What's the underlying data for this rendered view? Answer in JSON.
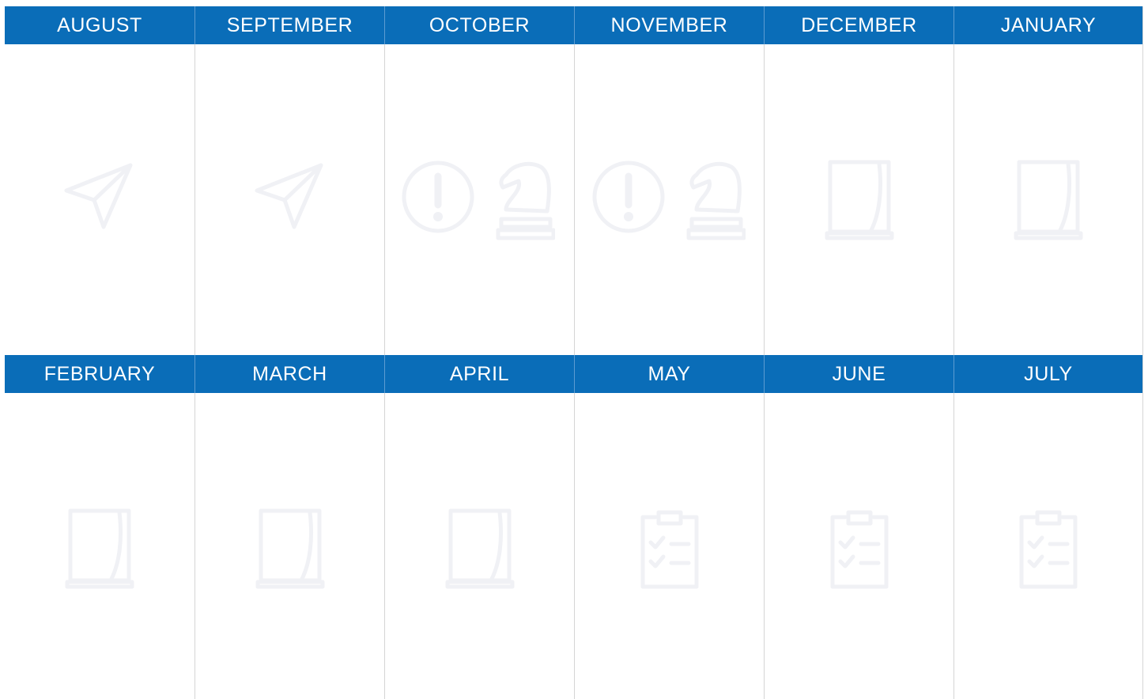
{
  "months_top": [
    {
      "name": "AUGUST",
      "icons": [
        "paper-plane-icon"
      ]
    },
    {
      "name": "SEPTEMBER",
      "icons": [
        "paper-plane-icon"
      ]
    },
    {
      "name": "OCTOBER",
      "icons": [
        "exclamation-circle-icon",
        "chess-knight-icon"
      ]
    },
    {
      "name": "NOVEMBER",
      "icons": [
        "exclamation-circle-icon",
        "chess-knight-icon"
      ]
    },
    {
      "name": "DECEMBER",
      "icons": [
        "curtain-window-icon"
      ]
    },
    {
      "name": "JANUARY",
      "icons": [
        "curtain-window-icon"
      ]
    }
  ],
  "months_bottom": [
    {
      "name": "FEBRUARY",
      "icons": [
        "curtain-window-icon"
      ]
    },
    {
      "name": "MARCH",
      "icons": [
        "curtain-window-icon"
      ]
    },
    {
      "name": "APRIL",
      "icons": [
        "curtain-window-icon"
      ]
    },
    {
      "name": "MAY",
      "icons": [
        "clipboard-checklist-icon"
      ]
    },
    {
      "name": "JUNE",
      "icons": [
        "clipboard-checklist-icon"
      ]
    },
    {
      "name": "JULY",
      "icons": [
        "clipboard-checklist-icon"
      ]
    }
  ],
  "colors": {
    "header_bg": "#0a6db8",
    "header_text": "#ffffff",
    "icon": "#f0f1f5",
    "grid_line": "#d5d5d5"
  }
}
